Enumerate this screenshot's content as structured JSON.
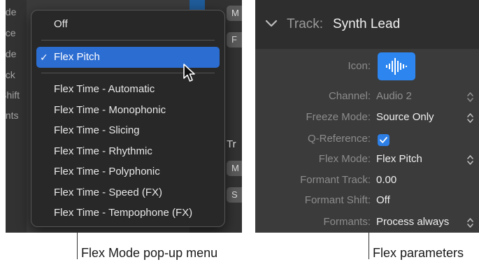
{
  "left_panel": {
    "background_labels": [
      "ode",
      "nce",
      "ode",
      "ack",
      "Shift",
      "ants"
    ],
    "background_buttons": [
      "M",
      "F",
      "M",
      "S"
    ],
    "background_text": "Tr",
    "flex_mode_menu": {
      "items": [
        {
          "label": "Off",
          "checked": false,
          "highlighted": false
        },
        {
          "label": "Flex Pitch",
          "checked": true,
          "highlighted": true
        },
        {
          "label": "Flex Time - Automatic",
          "checked": false,
          "highlighted": false
        },
        {
          "label": "Flex Time - Monophonic",
          "checked": false,
          "highlighted": false
        },
        {
          "label": "Flex Time - Slicing",
          "checked": false,
          "highlighted": false
        },
        {
          "label": "Flex Time - Rhythmic",
          "checked": false,
          "highlighted": false
        },
        {
          "label": "Flex Time - Polyphonic",
          "checked": false,
          "highlighted": false
        },
        {
          "label": "Flex Time - Speed (FX)",
          "checked": false,
          "highlighted": false
        },
        {
          "label": "Flex Time - Tempophone (FX)",
          "checked": false,
          "highlighted": false
        }
      ],
      "check_glyph": "✓",
      "highlight_color": "#2c6dd2"
    }
  },
  "right_panel": {
    "header": {
      "key": "Track:",
      "value": "Synth Lead",
      "icon": "chevron-down-icon"
    },
    "params": {
      "icon": {
        "label": "Icon:",
        "icon": "waveform-icon",
        "color": "#2d86f0"
      },
      "channel": {
        "label": "Channel:",
        "value": "Audio 2"
      },
      "freeze_mode": {
        "label": "Freeze Mode:",
        "value": "Source Only"
      },
      "q_reference": {
        "label": "Q-Reference:",
        "checked": true
      },
      "flex_mode": {
        "label": "Flex Mode:",
        "value": "Flex Pitch"
      },
      "formant_track": {
        "label": "Formant Track:",
        "value": "0.00"
      },
      "formant_shift": {
        "label": "Formant Shift:",
        "value": "Off"
      },
      "formants": {
        "label": "Formants:",
        "value": "Process always"
      }
    }
  },
  "captions": {
    "left": "Flex Mode pop-up menu",
    "right": "Flex parameters"
  }
}
